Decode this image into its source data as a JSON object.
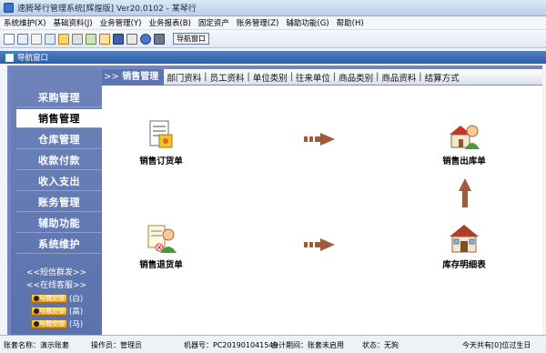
{
  "window": {
    "title": "速腾琴行管理系统[辉煌版] Ver20.0102  -  某琴行"
  },
  "menu": [
    "系统维护(X)",
    "基础资料(J)",
    "业务管理(Y)",
    "业务报表(B)",
    "固定资产",
    "账务管理(Z)",
    "辅助功能(G)",
    "帮助(H)"
  ],
  "toolbar": {
    "nav_button": "导航窗口"
  },
  "inner_window": {
    "title": "导航窗口"
  },
  "sidebar": {
    "items": [
      "采购管理",
      "销售管理",
      "仓库管理",
      "收款付款",
      "收入支出",
      "账务管理",
      "辅助功能",
      "系统维护"
    ],
    "active_index": 1,
    "links": [
      "<<短信群发>>",
      "<<在线客服>>"
    ],
    "qq": [
      {
        "badge": "与我交谈",
        "label": "(白)"
      },
      {
        "badge": "与我交谈",
        "label": "(高)"
      },
      {
        "badge": "与我交谈",
        "label": "(马)"
      }
    ]
  },
  "tabs": {
    "current_prefix": ">>",
    "current": "销售管理",
    "links": [
      "部门资料",
      "员工资料",
      "单位类别",
      "往来单位",
      "商品类别",
      "商品资料",
      "结算方式"
    ]
  },
  "flow": {
    "sales_order": "销售订货单",
    "sales_outbound": "销售出库单",
    "sales_return": "销售退货单",
    "stock_detail": "库存明细表"
  },
  "status": {
    "account": "账套名称：演示账套",
    "operator": "操作员：管理员",
    "machine": "机器号：PC201901041549",
    "period": "会计期间：账套未启用",
    "state": "状态：无狗",
    "notice": "今天共有[0]位过生日"
  },
  "colors": {
    "sidebar": "#6d83b9",
    "accent": "#5b74b3",
    "arrow": "#a05a3c"
  }
}
